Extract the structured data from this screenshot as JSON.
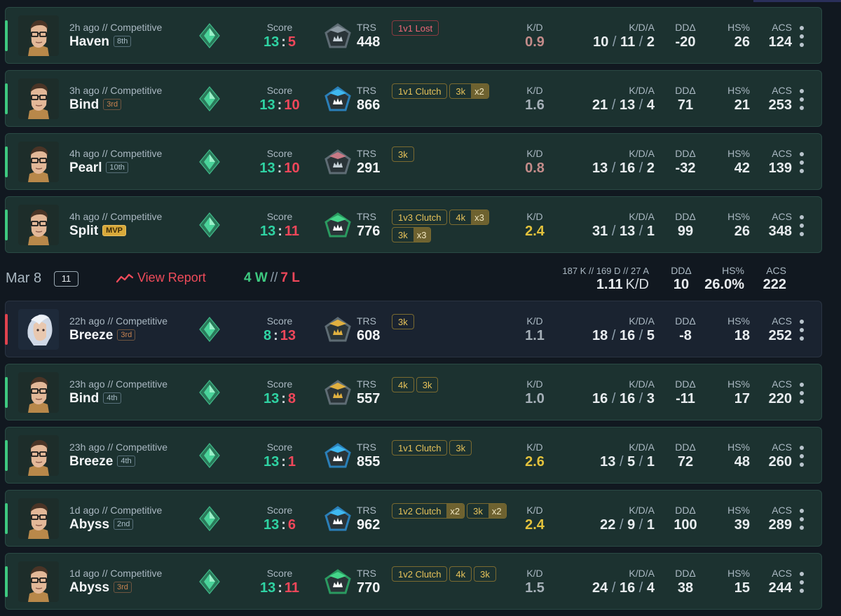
{
  "labels": {
    "score": "Score",
    "trs": "TRS",
    "kd": "K/D",
    "kda": "K/D/A",
    "dd": "DDΔ",
    "hs": "HS%",
    "acs": "ACS"
  },
  "colors": {
    "win": "#2fd3a3",
    "loss": "#f0475a",
    "accent_win_strip": "#3ec980",
    "accent_loss_strip": "#e0434e",
    "kd_good": "#e3c23c"
  },
  "matches_top": [
    {
      "ago": "2h ago // Competitive",
      "map": "Haven",
      "place": "8th",
      "place_style": "plain",
      "result": "win",
      "agent": "chamber",
      "score_left": "13",
      "score_right": "5",
      "trs": "448",
      "trs_tier": "gray",
      "badges": [
        {
          "text": "1v1 Lost",
          "style": "lost"
        }
      ],
      "kd": "0.9",
      "kd_tone": "low",
      "k": "10",
      "d": "11",
      "a": "2",
      "dd": "-20",
      "hs": "26",
      "acs": "124"
    },
    {
      "ago": "3h ago // Competitive",
      "map": "Bind",
      "place": "3rd",
      "place_style": "bronze",
      "result": "win",
      "agent": "chamber",
      "score_left": "13",
      "score_right": "10",
      "trs": "866",
      "trs_tier": "blue",
      "badges": [
        {
          "text": "1v1 Clutch"
        },
        {
          "text": "3k",
          "mult": "x2"
        }
      ],
      "kd": "1.6",
      "kd_tone": "mid",
      "k": "21",
      "d": "13",
      "a": "4",
      "dd": "71",
      "hs": "21",
      "acs": "253"
    },
    {
      "ago": "4h ago // Competitive",
      "map": "Pearl",
      "place": "10th",
      "place_style": "plain",
      "result": "win",
      "agent": "chamber",
      "score_left": "13",
      "score_right": "10",
      "trs": "291",
      "trs_tier": "pink",
      "badges": [
        {
          "text": "3k"
        }
      ],
      "kd": "0.8",
      "kd_tone": "low",
      "k": "13",
      "d": "16",
      "a": "2",
      "dd": "-32",
      "hs": "42",
      "acs": "139"
    },
    {
      "ago": "4h ago // Competitive",
      "map": "Split",
      "place": "MVP",
      "place_style": "mvp",
      "result": "win",
      "agent": "chamber",
      "score_left": "13",
      "score_right": "11",
      "trs": "776",
      "trs_tier": "green",
      "badges": [
        {
          "text": "1v3 Clutch"
        },
        {
          "text": "4k",
          "mult": "x3"
        },
        {
          "text": "3k",
          "mult": "x3"
        }
      ],
      "kd": "2.4",
      "kd_tone": "high",
      "k": "31",
      "d": "13",
      "a": "1",
      "dd": "99",
      "hs": "26",
      "acs": "348"
    }
  ],
  "day": {
    "date": "Mar 8",
    "count": "11",
    "report_label": "View Report",
    "wins": "4 W",
    "losses": "7 L",
    "sep": "//",
    "totals": "187 K // 169 D // 27 A",
    "kd": "1.11",
    "kd_unit": "K/D",
    "dd_label": "DDΔ",
    "dd": "10",
    "hs_label": "HS%",
    "hs": "26.0%",
    "acs_label": "ACS",
    "acs": "222"
  },
  "matches_bottom": [
    {
      "ago": "22h ago // Competitive",
      "map": "Breeze",
      "place": "3rd",
      "place_style": "bronze",
      "result": "loss",
      "agent": "jett",
      "score_left": "8",
      "score_right": "13",
      "trs": "608",
      "trs_tier": "gold",
      "badges": [
        {
          "text": "3k"
        }
      ],
      "kd": "1.1",
      "kd_tone": "mid",
      "k": "18",
      "d": "16",
      "a": "5",
      "dd": "-8",
      "hs": "18",
      "acs": "252"
    },
    {
      "ago": "23h ago // Competitive",
      "map": "Bind",
      "place": "4th",
      "place_style": "plain",
      "result": "win",
      "agent": "chamber",
      "score_left": "13",
      "score_right": "8",
      "trs": "557",
      "trs_tier": "gold",
      "badges": [
        {
          "text": "4k"
        },
        {
          "text": "3k"
        }
      ],
      "kd": "1.0",
      "kd_tone": "mid",
      "k": "16",
      "d": "16",
      "a": "3",
      "dd": "-11",
      "hs": "17",
      "acs": "220"
    },
    {
      "ago": "23h ago // Competitive",
      "map": "Breeze",
      "place": "4th",
      "place_style": "plain",
      "result": "win",
      "agent": "chamber",
      "score_left": "13",
      "score_right": "1",
      "trs": "855",
      "trs_tier": "blue",
      "badges": [
        {
          "text": "1v1 Clutch"
        },
        {
          "text": "3k"
        }
      ],
      "kd": "2.6",
      "kd_tone": "high",
      "k": "13",
      "d": "5",
      "a": "1",
      "dd": "72",
      "hs": "48",
      "acs": "260"
    },
    {
      "ago": "1d ago // Competitive",
      "map": "Abyss",
      "place": "2nd",
      "place_style": "plain",
      "result": "win",
      "agent": "chamber",
      "score_left": "13",
      "score_right": "6",
      "trs": "962",
      "trs_tier": "blue",
      "badges": [
        {
          "text": "1v2 Clutch",
          "mult": "x2"
        },
        {
          "text": "3k",
          "mult": "x2"
        }
      ],
      "kd": "2.4",
      "kd_tone": "high",
      "k": "22",
      "d": "9",
      "a": "1",
      "dd": "100",
      "hs": "39",
      "acs": "289"
    },
    {
      "ago": "1d ago // Competitive",
      "map": "Abyss",
      "place": "3rd",
      "place_style": "bronze",
      "result": "win",
      "agent": "chamber",
      "score_left": "13",
      "score_right": "11",
      "trs": "770",
      "trs_tier": "green",
      "badges": [
        {
          "text": "1v2 Clutch"
        },
        {
          "text": "4k"
        },
        {
          "text": "3k"
        }
      ],
      "kd": "1.5",
      "kd_tone": "mid",
      "k": "24",
      "d": "16",
      "a": "4",
      "dd": "38",
      "hs": "15",
      "acs": "244"
    }
  ]
}
